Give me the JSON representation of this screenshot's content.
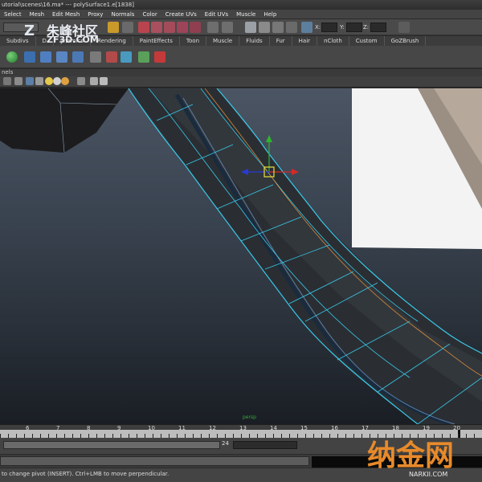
{
  "window": {
    "title": "utorial\\scenes\\16.ma* --- polySurface1.e[1838]"
  },
  "menus": [
    "Select",
    "Mesh",
    "Edit Mesh",
    "Proxy",
    "Normals",
    "Color",
    "Create UVs",
    "Edit UVs",
    "Muscle",
    "Help"
  ],
  "status_line": {
    "coord_labels": [
      "X:",
      "Y:",
      "Z:"
    ],
    "coord_values": [
      "",
      "",
      ""
    ]
  },
  "shelf_tabs": [
    "Subdivs",
    "D",
    "ynamics",
    "Rendering",
    "PaintEffects",
    "Toon",
    "Muscle",
    "Fluids",
    "Fur",
    "Hair",
    "nCloth",
    "Custom",
    "GoZBrush"
  ],
  "panel": {
    "menu_label": "nels"
  },
  "watermarks": {
    "top_cn": "朱峰社区",
    "top_en": "ZF3D.COM",
    "bottom_cn": "纳金网",
    "bottom_en": "NARKII.COM"
  },
  "timeline": {
    "frames": [
      "6",
      "7",
      "8",
      "9",
      "10",
      "11",
      "12",
      "13",
      "14",
      "15",
      "16",
      "17",
      "18",
      "19",
      "20"
    ],
    "current_frame": "24"
  },
  "viewport": {
    "camera_label": "persp"
  },
  "help_line": {
    "text": "to change pivot (INSERT).  Ctrl+LMB to move perpendicular."
  },
  "colors": {
    "viewport_top": "#4b5563",
    "wire_highlight": "#39c8e8",
    "edge_loop": "#d88a3a",
    "manip_x": "#d42a2a",
    "manip_y": "#2fb52f",
    "manip_z": "#2a3ad4"
  }
}
